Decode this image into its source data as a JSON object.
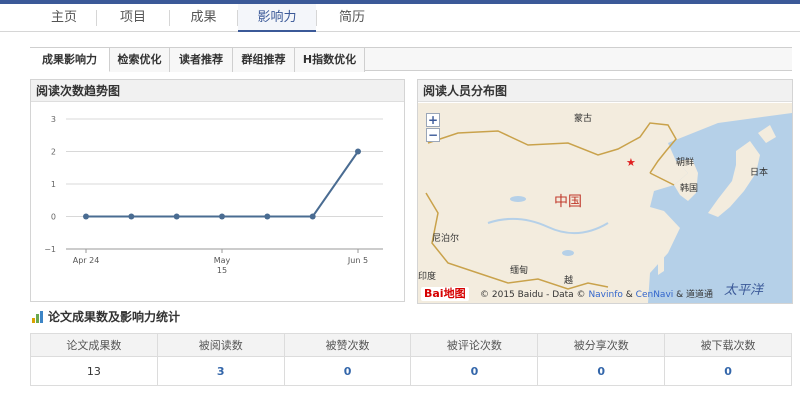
{
  "nav": {
    "items": [
      "主页",
      "项目",
      "成果",
      "影响力",
      "简历"
    ],
    "active_index": 3
  },
  "subtabs": {
    "items": [
      "成果影响力",
      "检索优化",
      "读者推荐",
      "群组推荐",
      "H指数优化"
    ],
    "active_index": 0
  },
  "reading_trend": {
    "title": "阅读次数趋势图"
  },
  "chart_data": {
    "type": "line",
    "title": "",
    "xlabel": "",
    "ylabel": "",
    "y_ticks": [
      "3",
      "2",
      "1",
      "0",
      "−1"
    ],
    "x_ticks": [
      "Apr 24",
      "May",
      "15",
      "Jun 5"
    ],
    "ylim": [
      -1,
      3
    ],
    "series": [
      {
        "values": [
          0,
          0,
          0,
          0,
          0,
          0,
          2
        ]
      }
    ],
    "grid": true,
    "line_color": "#4a6c92"
  },
  "reader_map": {
    "title": "阅读人员分布图",
    "zoom_in": "+",
    "zoom_out": "−",
    "labels": {
      "mongolia": "蒙古",
      "china": "中国",
      "dprk": "朝鲜",
      "korea": "韩国",
      "japan": "日本",
      "nepal": "尼泊尔",
      "india": "印度",
      "myanmar": "缅甸",
      "vietnam": "越",
      "pacific": "太平洋"
    },
    "logo": "Bai地图",
    "copyright_prefix": "© 2015 Baidu - Data ©",
    "copyright_link1": "Navinfo",
    "copyright_amp": "&",
    "copyright_link2": "CenNavi",
    "copyright_suffix": "& 道道通",
    "colors": {
      "water": "#b5d0e8",
      "land": "#f3ecde",
      "border": "#c9a24b",
      "marker": "#e02020"
    }
  },
  "stats": {
    "title": "论文成果数及影响力统计",
    "headers": [
      "论文成果数",
      "被阅读数",
      "被赞次数",
      "被评论次数",
      "被分享次数",
      "被下载次数"
    ],
    "values": [
      "13",
      "3",
      "0",
      "0",
      "0",
      "0"
    ]
  }
}
